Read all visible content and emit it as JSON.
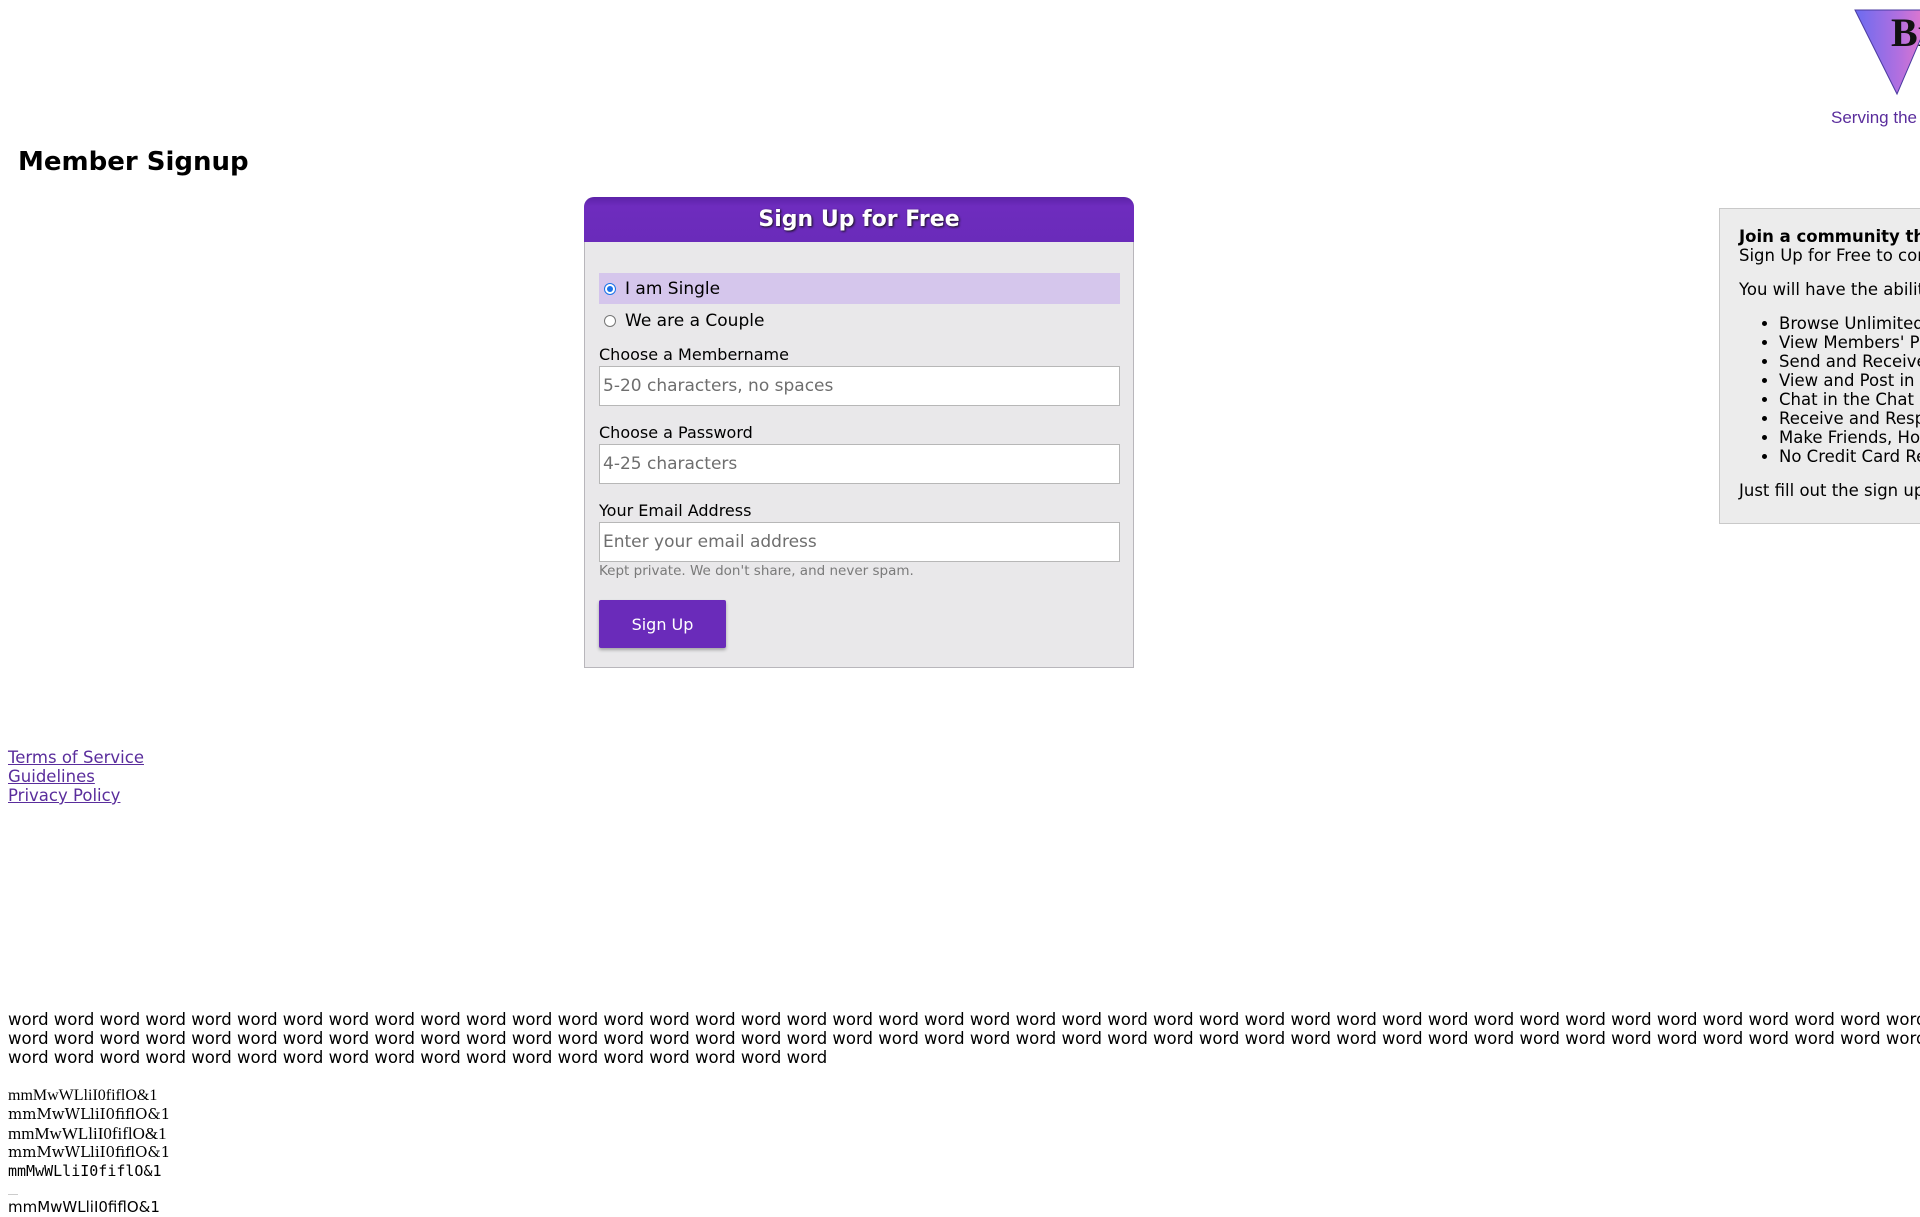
{
  "logo": {
    "text": "Bi",
    "tagline": "Serving the b"
  },
  "page_title": "Member Signup",
  "signup": {
    "header": "Sign Up for Free",
    "options": [
      {
        "label": "I am Single",
        "selected": true
      },
      {
        "label": "We are a Couple",
        "selected": false
      }
    ],
    "membername": {
      "label": "Choose a Membername",
      "placeholder": "5-20 characters, no spaces",
      "value": ""
    },
    "password": {
      "label": "Choose a Password",
      "placeholder": "4-25 characters",
      "value": ""
    },
    "email": {
      "label": "Your Email Address",
      "placeholder": "Enter your email address",
      "value": "",
      "hint": "Kept private. We don't share, and never spam."
    },
    "submit_label": "Sign Up"
  },
  "info": {
    "heading": "Join a community th",
    "intro": "Sign Up for Free to cor",
    "ability": "You will have the abilit",
    "items": [
      "Browse Unlimited",
      "View Members' Pl",
      "Send and Receive",
      "View and Post in t",
      "Chat in the Chat F",
      "Receive and Resp",
      "Make Friends, Hoo",
      "No Credit Card Re"
    ],
    "outro": "Just fill out the sign up"
  },
  "footer_links": [
    "Terms of Service",
    "Guidelines",
    "Privacy Policy"
  ],
  "font_test": {
    "words": "word word word word word word word word word word word word word word word word word word word word word word word word word word word word word word word word word word word word word word word word word word word word word word word word word word word word word word word word word word word word word word word word word word word word word word word word word word word word word word word word word word word word word word word word word word word word word word word word word word word word word word word word",
    "specimens": [
      "mmMwWLliI0fiflO&1",
      "mmMwWLliI0fiflO&1",
      "mmMwWLliI0fiflO&1",
      "mmMwWLliI0fiflO&1",
      "mmMwWLliI0fiflO&1",
      "mmMwWLliI0fiflO&1"
    ]
  },
  "colors": {
    "brand_purple": "#6a2bba",
    "selected_row": "#d5c6ec",
    "card_bg": "#e9e8ea",
    "link": "#5a2d9c"
  }
}
